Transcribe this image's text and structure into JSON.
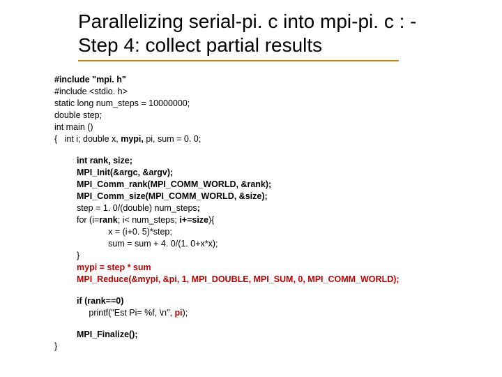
{
  "title_line1": "Parallelizing serial-pi. c into mpi-pi. c : -",
  "title_line2": "Step 4: collect partial results",
  "code": {
    "l1": "#include \"mpi. h\"",
    "l2": "#include <stdio. h>",
    "l3": "static long num_steps = 10000000;",
    "l4": "double step;",
    "l5": "int main ()",
    "l6a": "{   int i; double x, ",
    "l6b": "mypi,",
    "l6c": " pi, sum = 0. 0;",
    "b2_l1": "int rank, size;",
    "b2_l2": "MPI_Init(&argc, &argv);",
    "b2_l3": "MPI_Comm_rank(MPI_COMM_WORLD, &rank);",
    "b2_l4": "MPI_Comm_size(MPI_COMM_WORLD, &size);",
    "b2_l5a": "step = 1. 0/(double) num_steps",
    "b2_l5b": ";",
    "b2_l6a": "for (i=",
    "b2_l6b": "rank",
    "b2_l6c": "; i< num_steps; ",
    "b2_l6d": "i+=size",
    "b2_l6e": "){",
    "b2_l7": "             x = (i+0. 5)*step;",
    "b2_l8": "             sum = sum + 4. 0/(1. 0+x*x);",
    "b2_l9": "}",
    "b2_l10": "mypi = step * sum",
    "b2_l11": "MPI_Reduce(&mypi, &pi, 1, MPI_DOUBLE, MPI_SUM, 0, MPI_COMM_WORLD);",
    "b3_l1": "if (rank==0)",
    "b3_l2a": "     printf(\"Est Pi= %f, \\n\", ",
    "b3_l2b": "pi",
    "b3_l2c": ");",
    "b4_l1": "MPI_Finalize();",
    "close": "}"
  }
}
